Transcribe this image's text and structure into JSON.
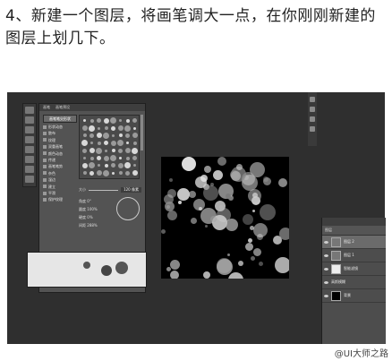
{
  "caption": "4、新建一个图层，将画笔调大一点，在你刚刚新建的图层上划几下。",
  "brush_panel": {
    "tab_brush": "画笔",
    "tab_presets": "画笔预设",
    "preset_button": "画笔笔尖形状",
    "options": [
      "形状动态",
      "散布",
      "纹理",
      "双重画笔",
      "颜色动态",
      "传递",
      "画笔笔势",
      "杂色",
      "湿边",
      "建立",
      "平滑",
      "保护纹理"
    ],
    "size_label": "大小",
    "size_value": "120 像素",
    "angle_label": "角度",
    "angle_value": "0°",
    "roundness_label": "圆度",
    "roundness_value": "100%",
    "hardness_label": "硬度",
    "hardness_value": "0%",
    "spacing_label": "间距",
    "spacing_value": "288%"
  },
  "layers_panel": {
    "title": "图层",
    "layers": [
      {
        "name": "图层 2",
        "thumb": "checker",
        "selected": true
      },
      {
        "name": "图层 1",
        "thumb": "checker",
        "selected": false
      },
      {
        "name": "智能滤镜",
        "thumb": "white",
        "selected": false
      },
      {
        "name": "高斯模糊",
        "thumb": "none",
        "selected": false
      },
      {
        "name": "背景",
        "thumb": "black",
        "selected": false
      }
    ]
  },
  "watermark": "@UI大师之路"
}
